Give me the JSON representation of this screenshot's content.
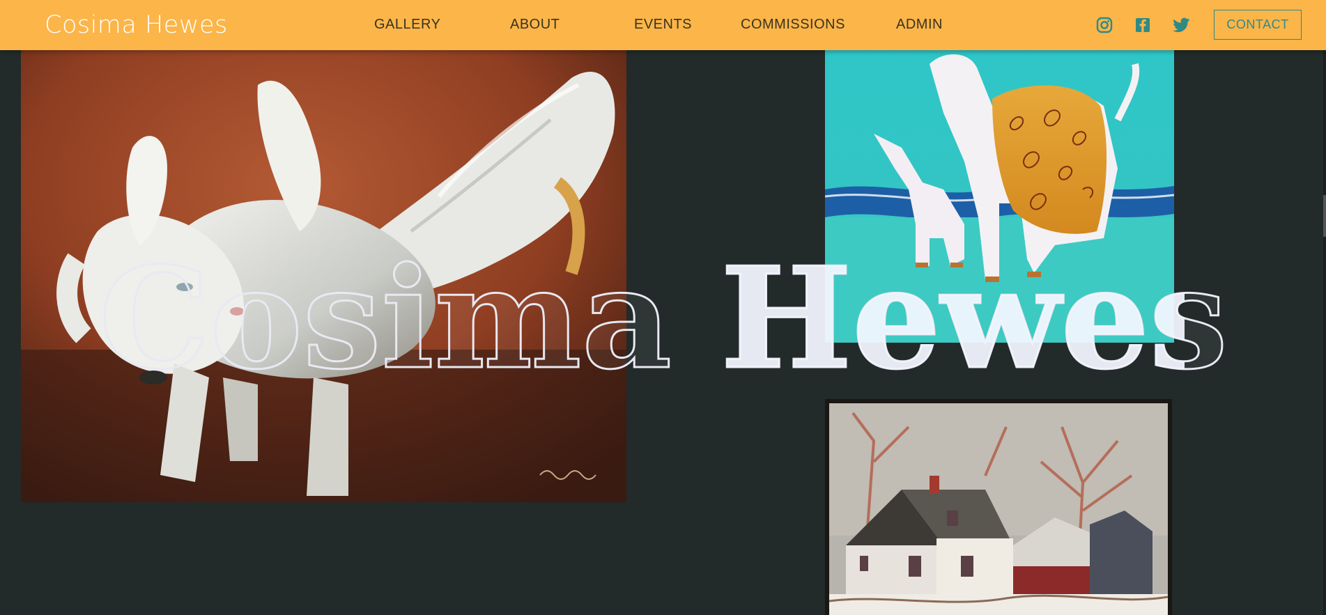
{
  "header": {
    "brand": "Cosima Hewes",
    "nav": [
      {
        "label": "GALLERY"
      },
      {
        "label": "ABOUT"
      },
      {
        "label": "EVENTS"
      },
      {
        "label": "COMMISSIONS"
      },
      {
        "label": "ADMIN"
      }
    ],
    "social_icons": [
      "instagram-icon",
      "facebook-icon",
      "twitter-icon"
    ],
    "contact_label": "CONTACT"
  },
  "hero": {
    "title": "Cosima Hewes"
  },
  "colors": {
    "header_bg": "#fbb549",
    "page_bg": "#232a2a",
    "accent": "#2f8a86",
    "brand_text": "#ffffff"
  }
}
